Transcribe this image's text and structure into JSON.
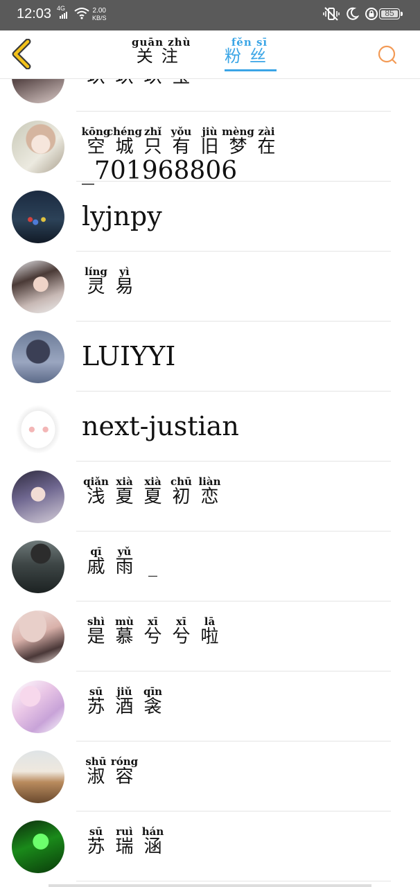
{
  "status_bar": {
    "time": "12:03",
    "network_type": "4G",
    "speed_value": "2.00",
    "speed_unit": "KB/S",
    "battery": "85"
  },
  "nav": {
    "tabs": [
      {
        "label": "关注",
        "pinyin": "guān zhù",
        "active": false
      },
      {
        "label": "粉丝",
        "pinyin": "fěn sī",
        "active": true
      }
    ],
    "accent_color": "#3aa5e6"
  },
  "fans": [
    {
      "chars": [
        {
          "hz": "玖",
          "py": ""
        },
        {
          "hz": "玖",
          "py": ""
        },
        {
          "hz": "玖",
          "py": ""
        },
        {
          "hz": "宝",
          "py": ""
        }
      ],
      "avatar": "dark-hair-girl"
    },
    {
      "chars": [
        {
          "hz": "空",
          "py": "kōng"
        },
        {
          "hz": "城",
          "py": "chéng"
        },
        {
          "hz": "只",
          "py": "zhǐ"
        },
        {
          "hz": "有",
          "py": "yǒu"
        },
        {
          "hz": "旧",
          "py": "jiù"
        },
        {
          "hz": "梦",
          "py": "mèng"
        },
        {
          "hz": "在",
          "py": "zài"
        }
      ],
      "extra": "_701968806",
      "avatar": "pale-girl"
    },
    {
      "text": "lyjnpy",
      "avatar": "night-tree"
    },
    {
      "chars": [
        {
          "hz": "灵",
          "py": "líng"
        },
        {
          "hz": "易",
          "py": "yì"
        }
      ],
      "avatar": "long-hair-girl"
    },
    {
      "text": "LUIYYI",
      "avatar": "just-now"
    },
    {
      "text": "next-justian",
      "avatar": "cartoon-ghost"
    },
    {
      "chars": [
        {
          "hz": "浅",
          "py": "qiǎn"
        },
        {
          "hz": "夏",
          "py": "xià"
        },
        {
          "hz": "夏",
          "py": "xià"
        },
        {
          "hz": "初",
          "py": "chū"
        },
        {
          "hz": "恋",
          "py": "liàn"
        }
      ],
      "avatar": "purple-hair-girl"
    },
    {
      "chars": [
        {
          "hz": "戚",
          "py": "qī"
        },
        {
          "hz": "雨",
          "py": "yǔ"
        },
        {
          "hz": "_",
          "py": ""
        }
      ],
      "avatar": "dark-coat"
    },
    {
      "chars": [
        {
          "hz": "是",
          "py": "shì"
        },
        {
          "hz": "慕",
          "py": "mù"
        },
        {
          "hz": "兮",
          "py": "xī"
        },
        {
          "hz": "兮",
          "py": "xī"
        },
        {
          "hz": "啦",
          "py": "lā"
        }
      ],
      "avatar": "hat-girl"
    },
    {
      "chars": [
        {
          "hz": "苏",
          "py": "sū"
        },
        {
          "hz": "酒",
          "py": "jiǔ"
        },
        {
          "hz": "衾",
          "py": "qīn"
        }
      ],
      "avatar": "pink-sketch"
    },
    {
      "chars": [
        {
          "hz": "淑",
          "py": "shū"
        },
        {
          "hz": "容",
          "py": "róng"
        }
      ],
      "avatar": "park-bench"
    },
    {
      "chars": [
        {
          "hz": "苏",
          "py": "sū"
        },
        {
          "hz": "瑞",
          "py": "ruì"
        },
        {
          "hz": "涵",
          "py": "hán"
        }
      ],
      "avatar": "green-girl"
    }
  ]
}
